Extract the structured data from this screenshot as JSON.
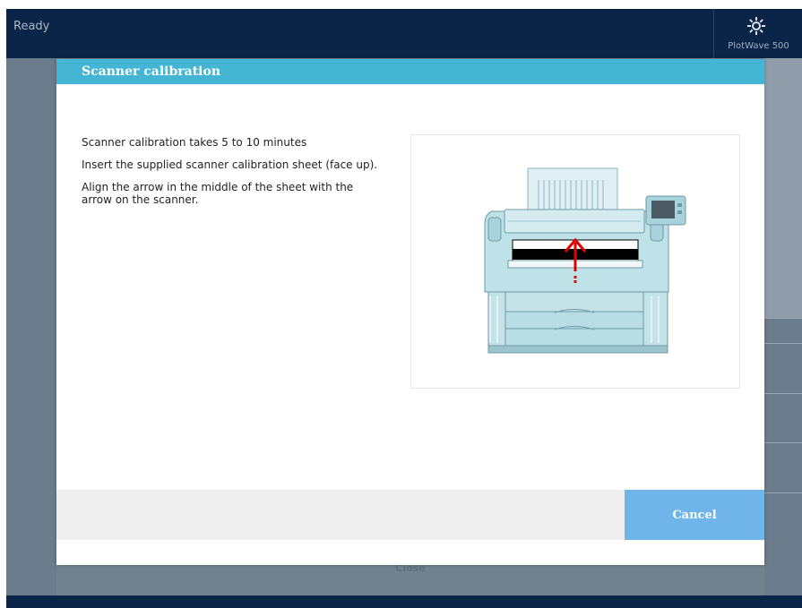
{
  "statusbar": {
    "status": "Ready",
    "device_name": "PlotWave 500"
  },
  "background": {
    "close_label": "Close"
  },
  "dialog": {
    "title": "Scanner calibration",
    "instructions": [
      "Scanner calibration takes 5 to 10 minutes",
      "Insert the supplied scanner calibration sheet (face up).",
      "Align the arrow in the middle of the sheet with the arrow on the scanner."
    ],
    "illustration": "scanner-illustration",
    "cancel_label": "Cancel"
  },
  "colors": {
    "topbar": "#0a2547",
    "dialog_header": "#44b6d4",
    "cancel_button": "#6fb5e9",
    "arrow": "#e30000"
  }
}
